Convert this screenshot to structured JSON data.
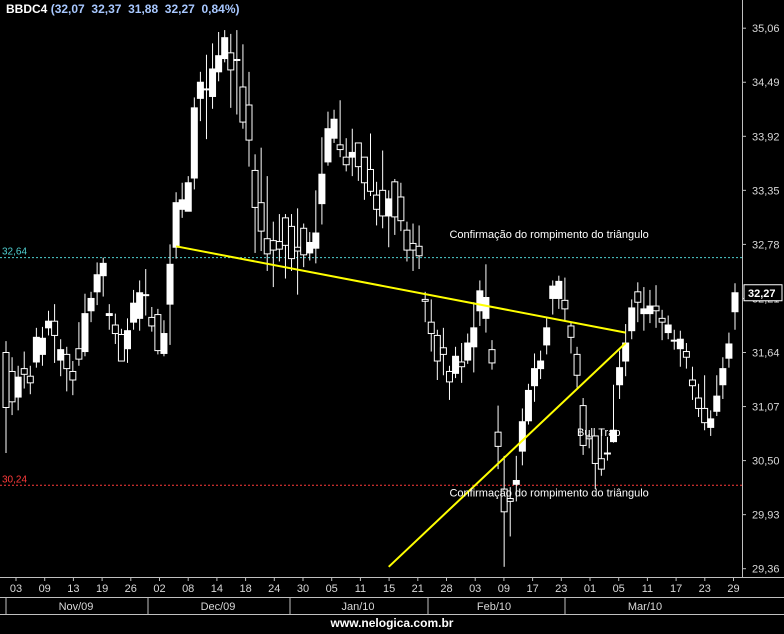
{
  "header": {
    "symbol": "BBDC4",
    "open": "32,07",
    "high": "32,37",
    "low": "31,88",
    "close": "32,27",
    "change": "0,84%"
  },
  "footer": {
    "site": "www.nelogica.com.br"
  },
  "colors": {
    "background": "#000000",
    "candle_up": "#ffffff",
    "candle_down": "#000000",
    "trendline": "#ffff00",
    "resistance": "#4fcfd0",
    "support": "#ff3b3b",
    "symbol": "#ffffff",
    "quote": "#a8c8ff"
  },
  "chart_data": {
    "type": "candlestick",
    "ylim": [
      29.3,
      35.1
    ],
    "y_ticks": [
      "35,06",
      "34,49",
      "33,92",
      "33,35",
      "32,78",
      "32,21",
      "31,64",
      "31,07",
      "30,50",
      "29,93",
      "29,36"
    ],
    "y_tick_values": [
      35.06,
      34.49,
      33.92,
      33.35,
      32.78,
      32.21,
      31.64,
      31.07,
      30.5,
      29.93,
      29.36
    ],
    "x_ticks": [
      "03",
      "09",
      "13",
      "19",
      "26",
      "02",
      "08",
      "14",
      "18",
      "24",
      "30",
      "05",
      "11",
      "15",
      "21",
      "28",
      "03",
      "09",
      "17",
      "23",
      "01",
      "05",
      "11",
      "17",
      "23",
      "29"
    ],
    "months": [
      "Nov/09",
      "Dec/09",
      "Jan/10",
      "Feb/10",
      "Mar/10"
    ],
    "last_price": {
      "value": 32.27,
      "label": "32,27"
    },
    "horizontal_lines": [
      {
        "name": "resistance",
        "value": 32.64,
        "label": "32,64"
      },
      {
        "name": "support",
        "value": 30.24,
        "label": "30,24"
      }
    ],
    "trendlines": [
      {
        "name": "upper",
        "points": [
          [
            28,
            32.76
          ],
          [
            102,
            31.85
          ]
        ]
      },
      {
        "name": "lower",
        "points": [
          [
            63,
            29.38
          ],
          [
            102,
            31.74
          ]
        ]
      }
    ],
    "annotations": [
      {
        "name": "confirmation-top",
        "text": "Confirmação do rompimento do triângulo",
        "at": [
          73,
          32.85
        ]
      },
      {
        "name": "confirmation-bottom",
        "text": "Confirmação do rompimento do triângulo",
        "at": [
          73,
          30.12
        ]
      },
      {
        "name": "bull-trap",
        "text": "Bull Trap",
        "at": [
          94,
          30.76
        ]
      }
    ],
    "candles": [
      [
        31.64,
        31.06,
        31.76,
        30.58
      ],
      [
        31.44,
        31.12,
        31.59,
        30.98
      ],
      [
        31.17,
        31.38,
        31.5,
        31.03
      ],
      [
        31.47,
        31.41,
        31.65,
        31.26
      ],
      [
        31.39,
        31.32,
        31.5,
        31.2
      ],
      [
        31.54,
        31.8,
        31.9,
        31.48
      ],
      [
        31.62,
        31.79,
        31.91,
        31.5
      ],
      [
        31.9,
        31.97,
        32.08,
        31.82
      ],
      [
        31.97,
        31.82,
        32.15,
        31.53
      ],
      [
        31.56,
        31.67,
        31.78,
        31.39
      ],
      [
        31.62,
        31.47,
        31.7,
        31.23
      ],
      [
        31.44,
        31.35,
        31.55,
        31.19
      ],
      [
        31.68,
        31.57,
        31.96,
        31.5
      ],
      [
        31.65,
        32.05,
        32.26,
        31.6
      ],
      [
        32.08,
        32.21,
        32.28,
        31.96
      ],
      [
        32.28,
        32.46,
        32.59,
        32.14
      ],
      [
        32.45,
        32.58,
        32.64,
        32.23
      ],
      [
        32.03,
        32.05,
        32.15,
        31.88
      ],
      [
        31.93,
        31.84,
        32.05,
        31.73
      ],
      [
        31.83,
        31.55,
        31.89,
        31.55
      ],
      [
        31.68,
        31.87,
        32.0,
        31.53
      ],
      [
        31.96,
        32.16,
        32.3,
        31.88
      ],
      [
        32.0,
        32.27,
        32.4,
        31.87
      ],
      [
        32.25,
        32.25,
        32.52,
        32.03
      ],
      [
        32.01,
        31.92,
        32.12,
        31.86
      ],
      [
        32.04,
        31.66,
        32.1,
        31.62
      ],
      [
        31.63,
        31.84,
        31.98,
        31.6
      ],
      [
        32.15,
        32.57,
        32.78,
        31.72
      ],
      [
        32.75,
        33.22,
        33.33,
        32.63
      ],
      [
        33.15,
        33.25,
        33.43,
        33.06
      ],
      [
        33.13,
        33.43,
        33.5,
        33.13
      ],
      [
        33.48,
        34.22,
        34.33,
        33.36
      ],
      [
        34.32,
        34.49,
        34.6,
        34.08
      ],
      [
        34.42,
        34.42,
        34.78,
        33.89
      ],
      [
        34.34,
        34.63,
        34.9,
        34.21
      ],
      [
        34.6,
        34.77,
        35.02,
        34.5
      ],
      [
        34.74,
        34.96,
        35.04,
        34.7
      ],
      [
        34.8,
        34.62,
        35.0,
        34.22
      ],
      [
        34.73,
        34.72,
        35.04,
        34.15
      ],
      [
        34.44,
        34.07,
        34.89,
        34.0
      ],
      [
        34.25,
        33.88,
        34.6,
        33.6
      ],
      [
        33.56,
        33.17,
        33.73,
        32.69
      ],
      [
        33.22,
        32.92,
        33.8,
        32.71
      ],
      [
        32.84,
        32.68,
        33.5,
        32.5
      ],
      [
        32.82,
        32.72,
        33.02,
        32.33
      ],
      [
        32.81,
        32.73,
        33.1,
        32.6
      ],
      [
        33.06,
        32.77,
        33.1,
        32.42
      ],
      [
        32.97,
        32.63,
        33.1,
        32.5
      ],
      [
        32.75,
        32.71,
        33.16,
        32.25
      ],
      [
        32.95,
        32.67,
        33.0,
        32.54
      ],
      [
        32.69,
        32.8,
        32.91,
        32.61
      ],
      [
        32.74,
        32.9,
        33.35,
        32.58
      ],
      [
        33.21,
        33.52,
        33.91,
        32.99
      ],
      [
        33.65,
        34.0,
        34.18,
        33.61
      ],
      [
        33.9,
        34.1,
        34.2,
        33.85
      ],
      [
        33.83,
        33.78,
        34.3,
        33.7
      ],
      [
        33.7,
        33.62,
        33.9,
        33.55
      ],
      [
        33.7,
        33.75,
        34.0,
        33.5
      ],
      [
        33.85,
        33.6,
        33.8,
        33.45
      ],
      [
        33.7,
        33.43,
        33.7,
        33.25
      ],
      [
        33.57,
        33.34,
        33.95,
        33.29
      ],
      [
        33.3,
        33.15,
        33.44,
        32.98
      ],
      [
        33.35,
        33.08,
        33.77,
        32.95
      ],
      [
        33.08,
        33.26,
        33.35,
        32.75
      ],
      [
        33.44,
        33.07,
        33.47,
        32.88
      ],
      [
        33.28,
        33.03,
        33.43,
        32.92
      ],
      [
        32.93,
        32.72,
        33.02,
        32.6
      ],
      [
        32.79,
        32.72,
        33.0,
        32.5
      ],
      [
        32.76,
        32.66,
        32.98,
        32.52
      ],
      [
        32.2,
        32.18,
        32.28,
        31.96
      ],
      [
        31.96,
        31.84,
        32.2,
        31.65
      ],
      [
        31.82,
        31.55,
        31.88,
        31.35
      ],
      [
        31.69,
        31.62,
        31.9,
        31.4
      ],
      [
        31.44,
        31.33,
        31.5,
        31.14
      ],
      [
        31.42,
        31.6,
        31.7,
        31.37
      ],
      [
        31.54,
        31.49,
        31.74,
        31.32
      ],
      [
        31.56,
        31.74,
        31.84,
        31.52
      ],
      [
        31.7,
        31.9,
        32.17,
        31.43
      ],
      [
        32.08,
        32.29,
        32.4,
        31.92
      ],
      [
        32.0,
        32.22,
        32.57,
        31.85
      ],
      [
        31.67,
        31.53,
        31.77,
        31.46
      ],
      [
        30.8,
        30.65,
        31.08,
        30.41
      ],
      [
        30.2,
        29.96,
        30.55,
        29.38
      ],
      [
        30.1,
        30.07,
        30.22,
        29.7
      ],
      [
        30.25,
        30.29,
        30.55,
        30.07
      ],
      [
        30.6,
        30.91,
        31.05,
        30.45
      ],
      [
        30.92,
        31.24,
        31.31,
        30.88
      ],
      [
        31.29,
        31.47,
        31.63,
        31.12
      ],
      [
        31.47,
        31.55,
        31.66,
        31.36
      ],
      [
        31.72,
        31.9,
        32.0,
        31.62
      ],
      [
        32.21,
        32.34,
        32.4,
        32.04
      ],
      [
        32.21,
        32.39,
        32.45,
        32.1
      ],
      [
        32.19,
        32.1,
        32.43,
        31.97
      ],
      [
        31.92,
        31.8,
        31.96,
        31.63
      ],
      [
        31.62,
        31.4,
        31.7,
        31.27
      ],
      [
        31.08,
        30.66,
        31.16,
        30.56
      ],
      [
        30.75,
        30.73,
        30.78,
        30.63
      ],
      [
        30.76,
        30.47,
        30.76,
        30.2
      ],
      [
        30.52,
        30.41,
        30.84,
        30.34
      ],
      [
        30.58,
        30.57,
        30.75,
        30.5
      ],
      [
        30.7,
        30.82,
        31.3,
        30.69
      ],
      [
        31.3,
        31.48,
        31.66,
        31.15
      ],
      [
        31.55,
        31.74,
        31.94,
        31.39
      ],
      [
        31.87,
        32.11,
        32.2,
        31.78
      ],
      [
        32.28,
        32.17,
        32.38,
        31.96
      ],
      [
        32.05,
        32.1,
        32.33,
        31.87
      ],
      [
        32.05,
        32.13,
        32.3,
        31.95
      ],
      [
        32.13,
        32.08,
        32.35,
        31.9
      ],
      [
        32.0,
        31.96,
        32.09,
        31.77
      ],
      [
        31.85,
        31.93,
        32.03,
        31.78
      ],
      [
        31.77,
        31.76,
        31.88,
        31.67
      ],
      [
        31.68,
        31.78,
        31.87,
        31.49
      ],
      [
        31.65,
        31.59,
        31.74,
        31.47
      ],
      [
        31.35,
        31.29,
        31.49,
        31.14
      ],
      [
        31.16,
        31.05,
        31.31,
        30.96
      ],
      [
        31.05,
        30.9,
        31.4,
        30.82
      ],
      [
        30.85,
        30.94,
        31.03,
        30.76
      ],
      [
        31.02,
        31.18,
        31.4,
        30.97
      ],
      [
        31.3,
        31.47,
        31.59,
        31.15
      ],
      [
        31.58,
        31.73,
        31.85,
        31.48
      ],
      [
        32.07,
        32.27,
        32.37,
        31.88
      ]
    ]
  }
}
